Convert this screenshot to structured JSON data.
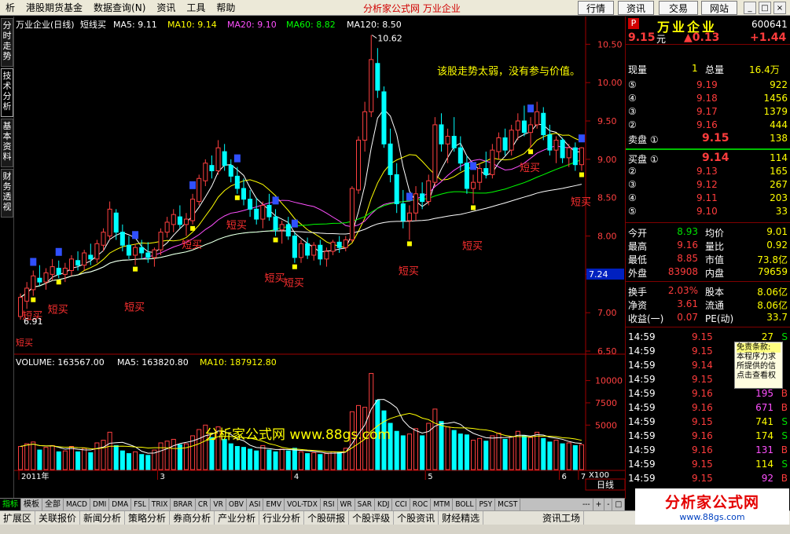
{
  "menu": {
    "items": [
      "析",
      "港股期货基金",
      "数据查询(N)",
      "资讯",
      "工具",
      "帮助"
    ],
    "title": "分析家公式网  万业企业",
    "right_buttons": [
      "行情",
      "资讯",
      "交易",
      "网站"
    ],
    "win_buttons": [
      "_",
      "□",
      "×"
    ]
  },
  "side_tabs": [
    "分时走势",
    "技术分析",
    "基本资料",
    "财务透视"
  ],
  "chart": {
    "header": {
      "name": "万业企业(日线)",
      "formula": "短线买",
      "ma5": "MA5: 9.11",
      "ma10": "MA10: 9.14",
      "ma20": "MA20: 9.10",
      "ma60": "MA60: 8.82",
      "ma120": "MA120: 8.50"
    },
    "annotation": "该股走势太弱，没有参与价值。",
    "high_label": "10.62",
    "low_label": "6.91",
    "signal_label": "短买",
    "current_price_tag": "7.24",
    "watermark": "分析家公式网 www.88gs.com",
    "volume_header": {
      "volume": "VOLUME: 163567.00",
      "ma5": "MA5: 163820.80",
      "ma10": "MA10: 187912.80"
    },
    "x_axis": [
      "2011年",
      "3",
      "4",
      "5",
      "6",
      "7"
    ],
    "period": "日线",
    "scale": "X100",
    "colors": {
      "up": "#ff4040",
      "down": "#00ffff",
      "ma5": "#ffffff",
      "ma10": "#ffff00",
      "ma20": "#ff50ff",
      "ma60": "#00ff00",
      "ma120": "#ffffff"
    }
  },
  "chart_data": {
    "type": "candlestick",
    "price_axis": {
      "ticks": [
        6.5,
        7.0,
        7.5,
        8.0,
        8.5,
        9.0,
        9.5,
        10.0,
        10.5
      ],
      "range": [
        6.48,
        10.78
      ]
    },
    "volume_axis": {
      "ticks": [
        5000,
        7500,
        10000
      ],
      "range": [
        0,
        11200
      ]
    },
    "ohlcv": [
      [
        6.95,
        7.25,
        6.91,
        7.2,
        2600
      ],
      [
        7.15,
        7.4,
        7.05,
        7.32,
        2900
      ],
      [
        7.3,
        7.55,
        7.22,
        7.48,
        3100
      ],
      [
        7.45,
        7.62,
        7.35,
        7.4,
        2200
      ],
      [
        7.4,
        7.58,
        7.3,
        7.52,
        2500
      ],
      [
        7.5,
        7.7,
        7.42,
        7.6,
        2700
      ],
      [
        7.58,
        7.68,
        7.45,
        7.5,
        2000
      ],
      [
        7.5,
        7.65,
        7.4,
        7.58,
        2100
      ],
      [
        7.55,
        7.75,
        7.48,
        7.7,
        2600
      ],
      [
        7.68,
        7.8,
        7.55,
        7.62,
        2000
      ],
      [
        7.62,
        7.82,
        7.55,
        7.78,
        2400
      ],
      [
        7.75,
        7.9,
        7.62,
        7.7,
        1900
      ],
      [
        7.7,
        7.95,
        7.65,
        7.9,
        3000
      ],
      [
        7.88,
        8.1,
        7.8,
        8.05,
        3300
      ],
      [
        8.0,
        8.45,
        7.95,
        8.35,
        4200
      ],
      [
        8.3,
        8.35,
        7.95,
        8.05,
        2700
      ],
      [
        8.05,
        8.15,
        7.8,
        7.88,
        2100
      ],
      [
        7.88,
        8.0,
        7.7,
        7.75,
        1800
      ],
      [
        7.75,
        7.9,
        7.62,
        7.85,
        2000
      ],
      [
        7.85,
        7.95,
        7.7,
        7.78,
        1700
      ],
      [
        7.78,
        7.92,
        7.65,
        7.72,
        1600
      ],
      [
        7.72,
        7.85,
        7.6,
        7.82,
        2200
      ],
      [
        7.82,
        8.1,
        7.75,
        8.05,
        3000
      ],
      [
        8.05,
        8.25,
        7.98,
        8.18,
        3200
      ],
      [
        8.15,
        8.35,
        8.05,
        8.28,
        3400
      ],
      [
        8.25,
        8.4,
        8.1,
        8.15,
        2800
      ],
      [
        8.15,
        8.3,
        8.0,
        8.22,
        2900
      ],
      [
        8.2,
        8.55,
        8.15,
        8.48,
        3800
      ],
      [
        8.45,
        8.8,
        8.4,
        8.75,
        4500
      ],
      [
        8.72,
        9.0,
        8.65,
        8.95,
        5000
      ],
      [
        8.92,
        9.05,
        8.75,
        8.85,
        3600
      ],
      [
        8.85,
        9.25,
        8.8,
        9.15,
        4800
      ],
      [
        9.1,
        9.2,
        8.85,
        8.92,
        3400
      ],
      [
        8.92,
        9.0,
        8.7,
        8.78,
        2900
      ],
      [
        8.78,
        8.9,
        8.55,
        8.62,
        2600
      ],
      [
        8.62,
        8.75,
        8.4,
        8.48,
        2500
      ],
      [
        8.48,
        8.6,
        8.25,
        8.35,
        2300
      ],
      [
        8.35,
        8.5,
        8.15,
        8.22,
        2100
      ],
      [
        8.22,
        8.45,
        8.1,
        8.4,
        2700
      ],
      [
        8.4,
        8.55,
        8.2,
        8.25,
        2200
      ],
      [
        8.25,
        8.35,
        8.0,
        8.08,
        2000
      ],
      [
        8.08,
        8.2,
        7.9,
        8.15,
        2300
      ],
      [
        8.15,
        8.25,
        7.95,
        8.0,
        2100
      ],
      [
        8.0,
        8.05,
        7.65,
        7.72,
        2400
      ],
      [
        7.72,
        7.95,
        7.65,
        7.9,
        2000
      ],
      [
        7.9,
        7.98,
        7.7,
        7.75,
        1800
      ],
      [
        7.75,
        7.92,
        7.68,
        7.88,
        1900
      ],
      [
        7.88,
        7.95,
        7.62,
        7.7,
        1700
      ],
      [
        7.7,
        7.85,
        7.6,
        7.8,
        1800
      ],
      [
        7.8,
        7.95,
        7.75,
        7.92,
        2000
      ],
      [
        7.92,
        8.0,
        7.78,
        7.85,
        1900
      ],
      [
        7.85,
        8.0,
        7.8,
        7.95,
        2400
      ],
      [
        7.95,
        8.65,
        7.92,
        8.62,
        6500
      ],
      [
        8.6,
        9.3,
        8.55,
        9.25,
        7200
      ],
      [
        9.25,
        9.75,
        9.1,
        9.62,
        7000
      ],
      [
        9.62,
        10.62,
        9.55,
        10.3,
        10800
      ],
      [
        10.25,
        10.45,
        9.8,
        9.9,
        7800
      ],
      [
        9.88,
        9.95,
        9.15,
        9.2,
        6600
      ],
      [
        9.2,
        9.4,
        8.7,
        8.8,
        5200
      ],
      [
        8.8,
        8.95,
        8.3,
        8.42,
        4300
      ],
      [
        8.42,
        8.6,
        8.1,
        8.2,
        3800
      ],
      [
        8.2,
        8.4,
        7.95,
        8.3,
        4000
      ],
      [
        8.3,
        8.65,
        8.2,
        8.55,
        4600
      ],
      [
        8.55,
        8.7,
        8.35,
        8.45,
        3800
      ],
      [
        8.45,
        8.8,
        8.4,
        8.72,
        5200
      ],
      [
        8.7,
        9.55,
        8.65,
        9.45,
        6800
      ],
      [
        9.45,
        9.6,
        9.1,
        9.2,
        5400
      ],
      [
        9.2,
        9.4,
        8.95,
        9.3,
        4800
      ],
      [
        9.3,
        9.55,
        9.1,
        9.15,
        4400
      ],
      [
        9.15,
        9.3,
        8.85,
        8.95,
        4000
      ],
      [
        8.95,
        9.05,
        8.55,
        8.62,
        3900
      ],
      [
        8.62,
        8.8,
        8.42,
        8.7,
        3300
      ],
      [
        8.7,
        8.95,
        8.6,
        8.88,
        3500
      ],
      [
        8.88,
        9.1,
        8.75,
        8.8,
        3200
      ],
      [
        8.8,
        9.2,
        8.75,
        9.12,
        3800
      ],
      [
        9.1,
        9.35,
        9.0,
        9.28,
        4100
      ],
      [
        9.28,
        9.4,
        9.05,
        9.12,
        3400
      ],
      [
        9.12,
        9.45,
        9.05,
        9.38,
        3700
      ],
      [
        9.38,
        9.6,
        9.25,
        9.5,
        4300
      ],
      [
        9.5,
        9.7,
        9.3,
        9.35,
        3800
      ],
      [
        9.35,
        9.55,
        9.15,
        9.45,
        3600
      ],
      [
        9.45,
        9.75,
        9.4,
        9.62,
        4200
      ],
      [
        9.6,
        9.68,
        9.25,
        9.32,
        3500
      ],
      [
        9.32,
        9.45,
        9.05,
        9.12,
        3100
      ],
      [
        9.12,
        9.3,
        8.95,
        9.25,
        3300
      ],
      [
        9.25,
        9.28,
        8.95,
        9.02,
        2900
      ],
      [
        9.02,
        9.2,
        8.9,
        9.15,
        3000
      ],
      [
        9.15,
        9.22,
        8.85,
        8.93,
        2700
      ],
      [
        8.93,
        9.16,
        8.85,
        9.15,
        2800
      ]
    ],
    "short_buy_signals": [
      2,
      6,
      18,
      27,
      34,
      40,
      43,
      61,
      71,
      80,
      88
    ],
    "ma_series": [
      "MA5",
      "MA10",
      "MA20",
      "MA60",
      "MA120"
    ]
  },
  "quote": {
    "badge": "P",
    "name": "万业企业",
    "code": "600641",
    "price": "9.15",
    "unit": "元",
    "change": "▲0.13",
    "pct": "+1.44",
    "now_vol_label": "现量",
    "now_vol": "1",
    "total_vol_label": "总量",
    "total_vol": "16.4万",
    "asks": [
      {
        "lvl": "⑤",
        "price": "9.19",
        "vol": "922"
      },
      {
        "lvl": "④",
        "price": "9.18",
        "vol": "1456"
      },
      {
        "lvl": "③",
        "price": "9.17",
        "vol": "1379"
      },
      {
        "lvl": "②",
        "price": "9.16",
        "vol": "444"
      },
      {
        "lvl": "卖盘 ①",
        "price": "9.15",
        "vol": "138"
      }
    ],
    "bids": [
      {
        "lvl": "买盘 ①",
        "price": "9.14",
        "vol": "114"
      },
      {
        "lvl": "②",
        "price": "9.13",
        "vol": "165"
      },
      {
        "lvl": "③",
        "price": "9.12",
        "vol": "267"
      },
      {
        "lvl": "④",
        "price": "9.11",
        "vol": "203"
      },
      {
        "lvl": "⑤",
        "price": "9.10",
        "vol": "33"
      }
    ],
    "stats": [
      {
        "k1": "今开",
        "v1": "8.93",
        "k2": "均价",
        "v2": "9.01"
      },
      {
        "k1": "最高",
        "v1": "9.16",
        "k2": "量比",
        "v2": "0.92"
      },
      {
        "k1": "最低",
        "v1": "8.85",
        "k2": "市值",
        "v2": "73.8亿"
      },
      {
        "k1": "外盘",
        "v1": "83908",
        "k2": "内盘",
        "v2": "79659"
      }
    ],
    "stats2": [
      {
        "k1": "换手",
        "v1": "2.03%",
        "k2": "股本",
        "v2": "8.06亿"
      },
      {
        "k1": "净资",
        "v1": "3.61",
        "k2": "流通",
        "v2": "8.06亿"
      },
      {
        "k1": "收益(一)",
        "v1": "0.07",
        "k2": "PE(动)",
        "v2": "33.7"
      }
    ],
    "ticks": [
      {
        "t": "14:59",
        "p": "9.15",
        "v": "27",
        "d": "S"
      },
      {
        "t": "14:59",
        "p": "9.15",
        "v": "",
        "d": ""
      },
      {
        "t": "14:59",
        "p": "9.14",
        "v": "",
        "d": ""
      },
      {
        "t": "14:59",
        "p": "9.15",
        "v": "",
        "d": ""
      },
      {
        "t": "14:59",
        "p": "9.16",
        "v": "195",
        "d": "B"
      },
      {
        "t": "14:59",
        "p": "9.16",
        "v": "671",
        "d": "B"
      },
      {
        "t": "14:59",
        "p": "9.15",
        "v": "741",
        "d": "S"
      },
      {
        "t": "14:59",
        "p": "9.16",
        "v": "174",
        "d": "S"
      },
      {
        "t": "14:59",
        "p": "9.16",
        "v": "131",
        "d": "B"
      },
      {
        "t": "14:59",
        "p": "9.15",
        "v": "114",
        "d": "S"
      },
      {
        "t": "14:59",
        "p": "9.15",
        "v": "92",
        "d": "B"
      }
    ],
    "tooltip": [
      "免责条款:",
      "本程序力求",
      "所提供的信",
      "点击查看权"
    ]
  },
  "indicator_tabs": [
    "指标",
    "模板",
    "全部",
    "MACD",
    "DMI",
    "DMA",
    "FSL",
    "TRIX",
    "BRAR",
    "CR",
    "VR",
    "OBV",
    "ASI",
    "EMV",
    "VOL-TDX",
    "RSI",
    "WR",
    "SAR",
    "KDJ",
    "CCI",
    "ROC",
    "MTM",
    "BOLL",
    "PSY",
    "MCST"
  ],
  "indicator_right": [
    "---",
    "+",
    "-",
    "□"
  ],
  "bottom_tabs": [
    "扩展区",
    "关联报价",
    "新闻分析",
    "策略分析",
    "券商分析",
    "产业分析",
    "行业分析",
    "个股研报",
    "个股评级",
    "个股资讯",
    "财经精选"
  ],
  "bottom_right": "资讯工场",
  "logo": {
    "title": "分析家公式网",
    "url": "www.88gs.com"
  }
}
